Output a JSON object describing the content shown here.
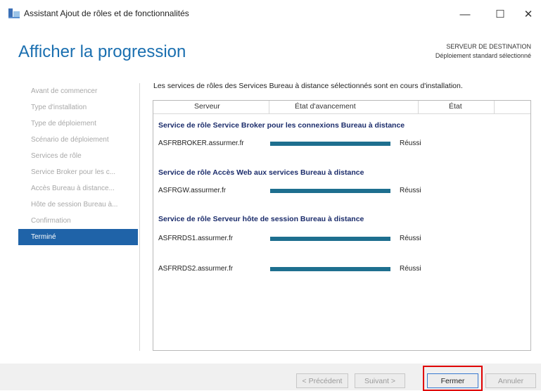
{
  "window": {
    "title": "Assistant Ajout de rôles et de fonctionnalités",
    "controls": {
      "minimize": "—",
      "maximize": "☐",
      "close": "✕"
    }
  },
  "header": {
    "title": "Afficher la progression",
    "destination_label": "SERVEUR DE DESTINATION",
    "destination_value": "Déploiement standard sélectionné"
  },
  "nav": {
    "items": [
      {
        "label": "Avant de commencer",
        "active": false
      },
      {
        "label": "Type d'installation",
        "active": false
      },
      {
        "label": "Type de déploiement",
        "active": false
      },
      {
        "label": "Scénario de déploiement",
        "active": false
      },
      {
        "label": "Services de rôle",
        "active": false
      },
      {
        "label": "Service Broker pour les c...",
        "active": false
      },
      {
        "label": "Accès Bureau à distance...",
        "active": false
      },
      {
        "label": "Hôte de session Bureau à...",
        "active": false
      },
      {
        "label": "Confirmation",
        "active": false
      },
      {
        "label": "Terminé",
        "active": true
      }
    ]
  },
  "main": {
    "intro": "Les services de rôles des Services Bureau à distance sélectionnés sont en cours d'installation.",
    "columns": {
      "server": "Serveur",
      "progress": "État d'avancement",
      "status": "État"
    },
    "groups": [
      {
        "title": "Service de rôle Service Broker pour les connexions Bureau à distance",
        "rows": [
          {
            "server": "ASFRBROKER.assurmer.fr",
            "progress": 1.0,
            "status": "Réussi"
          }
        ]
      },
      {
        "title": "Service de rôle Accès Web aux services Bureau à distance",
        "rows": [
          {
            "server": "ASFRGW.assurmer.fr",
            "progress": 1.0,
            "status": "Réussi"
          }
        ]
      },
      {
        "title": "Service de rôle Serveur hôte de session Bureau à distance",
        "rows": [
          {
            "server": "ASFRRDS1.assurmer.fr",
            "progress": 1.0,
            "status": "Réussi"
          },
          {
            "server": "ASFRRDS2.assurmer.fr",
            "progress": 1.0,
            "status": "Réussi"
          }
        ]
      }
    ]
  },
  "footer": {
    "previous": "< Précédent",
    "next": "Suivant >",
    "close": "Fermer",
    "cancel": "Annuler"
  },
  "colors": {
    "accent": "#1f63a8",
    "title": "#1a6fb0",
    "progress": "#1e6f8f",
    "highlight": "#e00000"
  }
}
